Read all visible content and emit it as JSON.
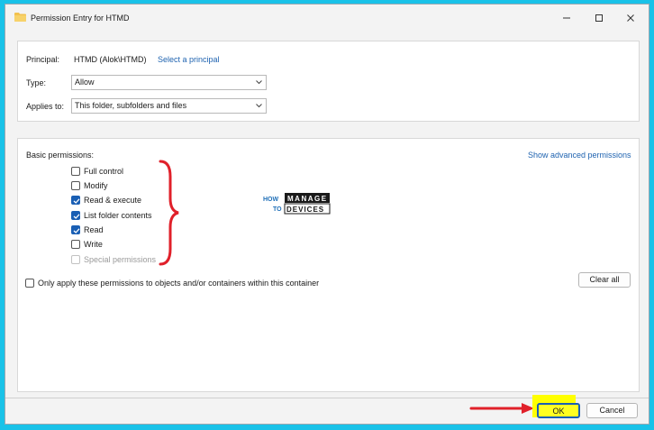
{
  "window": {
    "title": "Permission Entry for HTMD"
  },
  "principal": {
    "label": "Principal:",
    "value": "HTMD (Alok\\HTMD)",
    "select_link": "Select a principal"
  },
  "type": {
    "label": "Type:",
    "value": "Allow"
  },
  "applies_to": {
    "label": "Applies to:",
    "value": "This folder, subfolders and files"
  },
  "permissions": {
    "heading": "Basic permissions:",
    "advanced_link": "Show advanced permissions",
    "items": [
      {
        "label": "Full control",
        "checked": false,
        "disabled": false
      },
      {
        "label": "Modify",
        "checked": false,
        "disabled": false
      },
      {
        "label": "Read & execute",
        "checked": true,
        "disabled": false
      },
      {
        "label": "List folder contents",
        "checked": true,
        "disabled": false
      },
      {
        "label": "Read",
        "checked": true,
        "disabled": false
      },
      {
        "label": "Write",
        "checked": false,
        "disabled": false
      },
      {
        "label": "Special permissions",
        "checked": false,
        "disabled": true
      }
    ],
    "only_apply_label": "Only apply these permissions to objects and/or containers within this container",
    "only_apply_checked": false,
    "clear_all_label": "Clear all"
  },
  "logo": {
    "how": "HOW",
    "to": "TO",
    "manage": "MANAGE",
    "devices": "DEVICES"
  },
  "footer": {
    "ok_label": "OK",
    "cancel_label": "Cancel"
  },
  "colors": {
    "accent": "#1a5fb4",
    "link": "#1f63b0",
    "annotation_red": "#e0202a",
    "highlight_yellow": "#ffff00",
    "background": "#19c2e8"
  },
  "icons": {
    "title": "folder-icon",
    "minimize": "minimize-icon",
    "maximize": "maximize-icon",
    "close": "close-icon",
    "dropdown": "chevron-down-icon"
  }
}
